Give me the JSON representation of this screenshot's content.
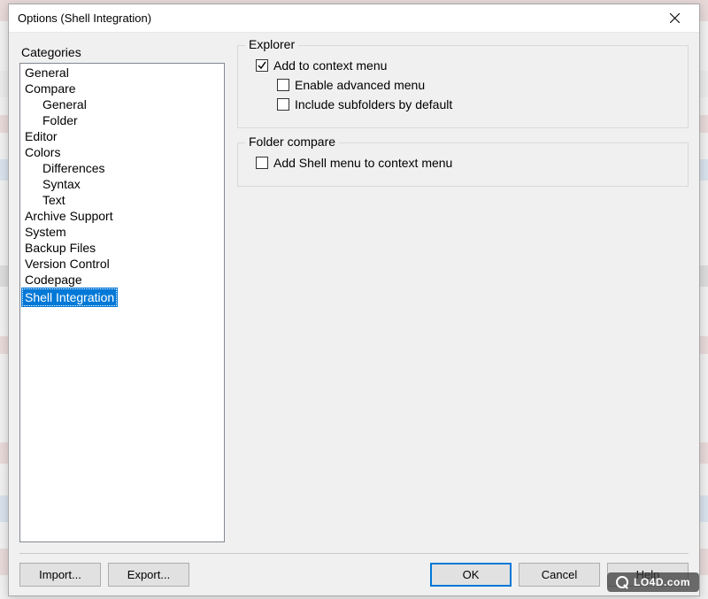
{
  "window": {
    "title": "Options (Shell Integration)"
  },
  "sidebar": {
    "label": "Categories",
    "items": [
      {
        "label": "General",
        "indent": false,
        "selected": false
      },
      {
        "label": "Compare",
        "indent": false,
        "selected": false
      },
      {
        "label": "General",
        "indent": true,
        "selected": false
      },
      {
        "label": "Folder",
        "indent": true,
        "selected": false
      },
      {
        "label": "Editor",
        "indent": false,
        "selected": false
      },
      {
        "label": "Colors",
        "indent": false,
        "selected": false
      },
      {
        "label": "Differences",
        "indent": true,
        "selected": false
      },
      {
        "label": "Syntax",
        "indent": true,
        "selected": false
      },
      {
        "label": "Text",
        "indent": true,
        "selected": false
      },
      {
        "label": "Archive Support",
        "indent": false,
        "selected": false
      },
      {
        "label": "System",
        "indent": false,
        "selected": false
      },
      {
        "label": "Backup Files",
        "indent": false,
        "selected": false
      },
      {
        "label": "Version Control",
        "indent": false,
        "selected": false
      },
      {
        "label": "Codepage",
        "indent": false,
        "selected": false
      },
      {
        "label": "Shell Integration",
        "indent": false,
        "selected": true
      }
    ]
  },
  "settings": {
    "group1": {
      "title": "Explorer",
      "chk_context": {
        "label": "Add to context menu",
        "checked": true
      },
      "chk_advanced": {
        "label": "Enable advanced menu",
        "checked": false
      },
      "chk_subfolders": {
        "label": "Include subfolders by default",
        "checked": false
      }
    },
    "group2": {
      "title": "Folder compare",
      "chk_shellmenu": {
        "label": "Add Shell menu to context menu",
        "checked": false
      }
    }
  },
  "buttons": {
    "import": "Import...",
    "export": "Export...",
    "ok": "OK",
    "cancel": "Cancel",
    "help": "Help"
  },
  "watermark": "LO4D.com"
}
